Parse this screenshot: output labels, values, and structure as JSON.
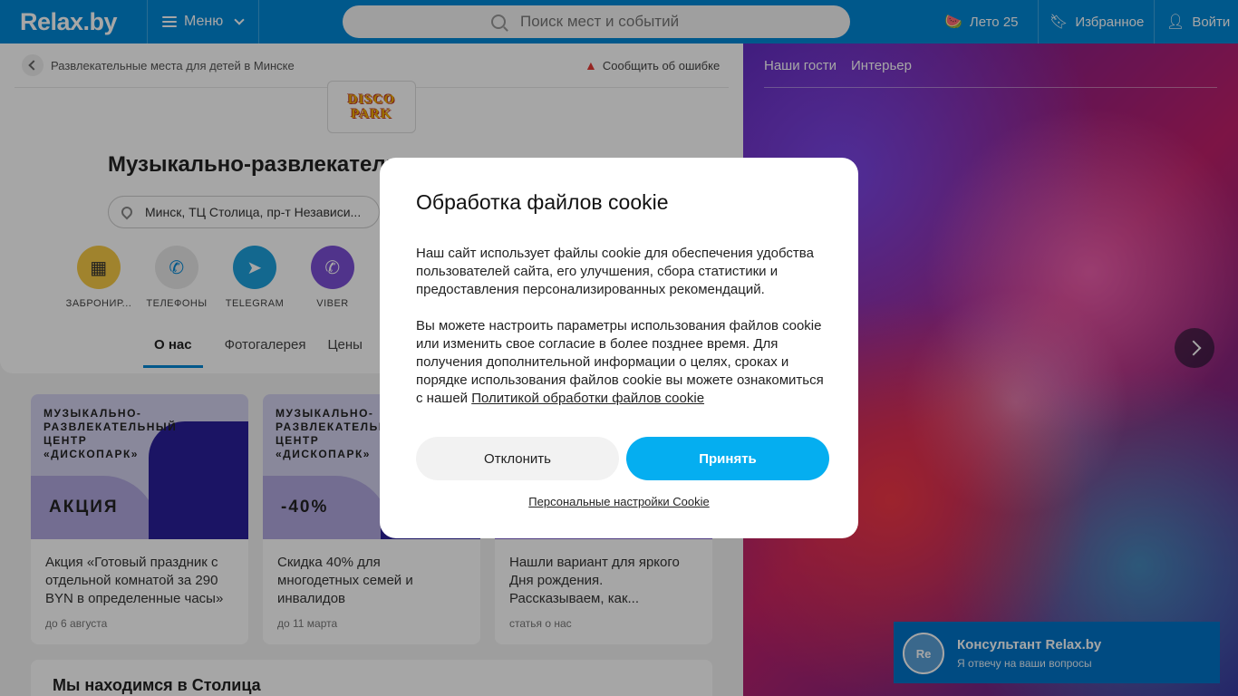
{
  "header": {
    "logo": "Relax.by",
    "menu_label": "Меню",
    "search_placeholder": "Поиск мест и событий",
    "summer_label": "Лето 25",
    "favorites_label": "Избранное",
    "login_label": "Войти"
  },
  "breadcrumb": {
    "label": "Развлекательные места для детей в Минске",
    "report_label": "Сообщить об ошибке"
  },
  "place": {
    "logo_text": "DISCO PARK",
    "title": "Музыкально-развлекатель",
    "address": "Минск, ТЦ Столица, пр-т Независи..."
  },
  "actions": [
    {
      "label": "ЗАБРОНИР...",
      "color": "#f6c945"
    },
    {
      "label": "ТЕЛЕФОНЫ",
      "color": "#e8e8e8"
    },
    {
      "label": "TELEGRAM",
      "color": "#1ea0dc"
    },
    {
      "label": "VIBER",
      "color": "#7b4fd6"
    }
  ],
  "tabs": [
    "О нас",
    "Фотогалерея",
    "Цены"
  ],
  "promos": [
    {
      "banner_text": "МУЗЫКАЛЬНО-\nРАЗВЛЕКАТЕЛЬНЫЙ\nЦЕНТР\n«ДИСКОПАРК»",
      "badge": "АКЦИЯ",
      "desc": "Акция «Готовый праздник с отдельной комнатой за 290 BYN в определенные часы»",
      "date": "до 6 августа"
    },
    {
      "banner_text": "МУЗЫКАЛЬНО-\nРАЗВЛЕКАТЕЛЬНЫЙ\nЦЕНТР\n«ДИСКОПАРК»",
      "badge": "-40%",
      "desc": "Скидка 40% для многодетных семей и инвалидов",
      "date": "до 11 марта"
    },
    {
      "banner_text": "",
      "badge": "",
      "desc": "Нашли вариант для яркого Дня рождения. Рассказываем, как...",
      "date": "статья о нас"
    }
  ],
  "location_heading": "Мы находимся в Столица",
  "photo_tabs": [
    "Наши гости",
    "Интерьер"
  ],
  "consultant": {
    "avatar": "Re",
    "name": "Консультант Relax.by",
    "subtitle": "Я отвечу на ваши вопросы"
  },
  "cookie_modal": {
    "title": "Обработка файлов cookie",
    "para1": "Наш сайт использует файлы cookie для обеспечения удобства пользователей сайта, его улучшения, сбора статистики и предоставления персонализированных рекомендаций.",
    "para2": "Вы можете настроить параметры использования файлов cookie или изменить свое согласие в более позднее время. Для получения дополнительной информации о целях, сроках и порядке использования файлов cookie вы можете ознакомиться с нашей ",
    "policy_link": "Политикой обработки файлов cookie",
    "decline_label": "Отклонить",
    "accept_label": "Принять",
    "settings_label": "Персональные настройки Cookie"
  }
}
